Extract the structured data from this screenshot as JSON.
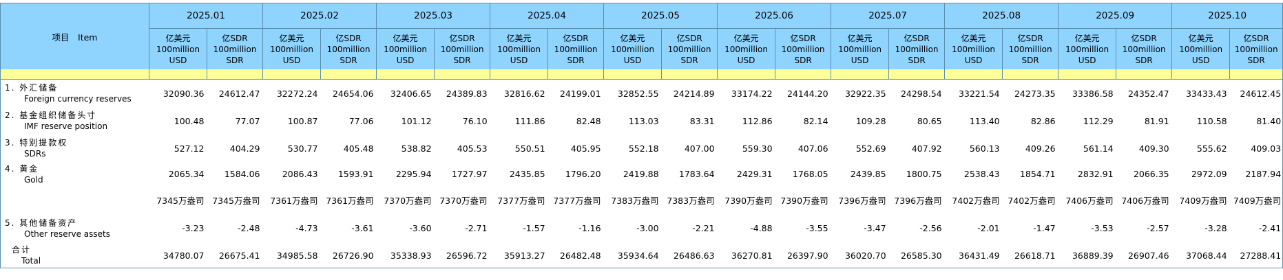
{
  "header": {
    "item_label": "项目　Item",
    "months": [
      "2025.01",
      "2025.02",
      "2025.03",
      "2025.04",
      "2025.05",
      "2025.06",
      "2025.07",
      "2025.08",
      "2025.09",
      "2025.10"
    ],
    "units": {
      "usd": [
        "亿美元",
        "100million",
        "USD"
      ],
      "sdr": [
        "亿SDR",
        "100million",
        "SDR"
      ]
    }
  },
  "colors": {
    "header_bg": "#8fd3ff",
    "separator_bg": "#ffff99",
    "border": "#5a8fb0"
  },
  "rows": [
    {
      "cn": "1. 外汇储备",
      "en": "Foreign currency reserves",
      "values": [
        "32090.36",
        "24612.47",
        "32272.24",
        "24654.06",
        "32406.65",
        "24389.83",
        "32816.62",
        "24199.01",
        "32852.55",
        "24214.89",
        "33174.22",
        "24144.20",
        "32922.35",
        "24298.54",
        "33221.54",
        "24273.35",
        "33386.58",
        "24352.47",
        "33433.43",
        "24612.45"
      ]
    },
    {
      "cn": "2. 基金组织储备头寸",
      "en": "IMF reserve position",
      "values": [
        "100.48",
        "77.07",
        "100.87",
        "77.06",
        "101.12",
        "76.10",
        "111.86",
        "82.48",
        "113.03",
        "83.31",
        "112.86",
        "82.14",
        "109.28",
        "80.65",
        "113.40",
        "82.86",
        "112.29",
        "81.91",
        "110.58",
        "81.40"
      ]
    },
    {
      "cn": "3. 特别提款权",
      "en": "SDRs",
      "values": [
        "527.12",
        "404.29",
        "530.77",
        "405.48",
        "538.82",
        "405.53",
        "550.51",
        "405.95",
        "552.18",
        "407.00",
        "559.30",
        "407.06",
        "552.69",
        "407.92",
        "560.13",
        "409.26",
        "561.14",
        "409.30",
        "555.62",
        "409.03"
      ]
    },
    {
      "cn": "4. 黄金",
      "en": "Gold",
      "values": [
        "2065.34",
        "1584.06",
        "2086.43",
        "1593.91",
        "2295.94",
        "1727.97",
        "2435.85",
        "1796.20",
        "2419.88",
        "1783.64",
        "2429.31",
        "1768.05",
        "2439.85",
        "1800.75",
        "2538.43",
        "1854.71",
        "2832.91",
        "2066.35",
        "2972.09",
        "2187.94"
      ]
    },
    {
      "cn": "",
      "en": "",
      "values": [
        "7345万盎司",
        "7345万盎司",
        "7361万盎司",
        "7361万盎司",
        "7370万盎司",
        "7370万盎司",
        "7377万盎司",
        "7377万盎司",
        "7383万盎司",
        "7383万盎司",
        "7390万盎司",
        "7390万盎司",
        "7396万盎司",
        "7396万盎司",
        "7402万盎司",
        "7402万盎司",
        "7406万盎司",
        "7406万盎司",
        "7409万盎司",
        "7409万盎司"
      ]
    },
    {
      "cn": "5. 其他储备资产",
      "en": "Other reserve assets",
      "values": [
        "-3.23",
        "-2.48",
        "-4.73",
        "-3.61",
        "-3.60",
        "-2.71",
        "-1.57",
        "-1.16",
        "-3.00",
        "-2.21",
        "-4.88",
        "-3.55",
        "-3.47",
        "-2.56",
        "-2.01",
        "-1.47",
        "-3.53",
        "-2.57",
        "-3.28",
        "-2.41"
      ]
    },
    {
      "cn": "合计",
      "en": "Total",
      "values": [
        "34780.07",
        "26675.41",
        "34985.58",
        "26726.90",
        "35338.93",
        "26596.72",
        "35913.27",
        "26482.48",
        "35934.64",
        "26486.63",
        "36270.81",
        "26397.90",
        "36020.70",
        "26585.30",
        "36431.49",
        "26618.71",
        "36889.39",
        "26907.46",
        "37068.44",
        "27288.41"
      ]
    }
  ]
}
